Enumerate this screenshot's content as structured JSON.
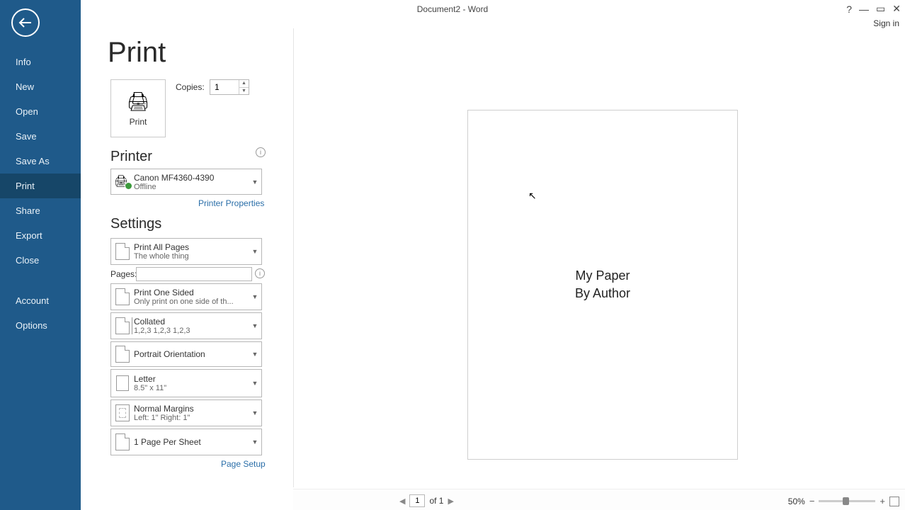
{
  "window": {
    "title": "Document2 - Word",
    "signin": "Sign in"
  },
  "sidebar": {
    "items": [
      {
        "label": "Info"
      },
      {
        "label": "New"
      },
      {
        "label": "Open"
      },
      {
        "label": "Save"
      },
      {
        "label": "Save As"
      },
      {
        "label": "Print"
      },
      {
        "label": "Share"
      },
      {
        "label": "Export"
      },
      {
        "label": "Close"
      },
      {
        "label": "Account"
      },
      {
        "label": "Options"
      }
    ]
  },
  "page": {
    "title": "Print"
  },
  "print_button": {
    "label": "Print"
  },
  "copies": {
    "label": "Copies:",
    "value": "1"
  },
  "printer_section": {
    "heading": "Printer",
    "selected": {
      "name": "Canon MF4360-4390",
      "status": "Offline"
    },
    "properties_link": "Printer Properties"
  },
  "settings_section": {
    "heading": "Settings",
    "print_what": {
      "title": "Print All Pages",
      "sub": "The whole thing"
    },
    "pages": {
      "label": "Pages:",
      "value": ""
    },
    "sides": {
      "title": "Print One Sided",
      "sub": "Only print on one side of th..."
    },
    "collation": {
      "title": "Collated",
      "sub": "1,2,3    1,2,3    1,2,3"
    },
    "orientation": {
      "title": "Portrait Orientation"
    },
    "paper": {
      "title": "Letter",
      "sub": "8.5\" x 11\""
    },
    "margins": {
      "title": "Normal Margins",
      "sub": "Left:  1\"    Right:  1\""
    },
    "pages_per_sheet": {
      "title": "1 Page Per Sheet"
    },
    "page_setup_link": "Page Setup"
  },
  "preview": {
    "doc_title": "My Paper",
    "doc_author": "By Author"
  },
  "status": {
    "current_page": "1",
    "page_of": "of 1",
    "zoom_pct": "50%"
  }
}
